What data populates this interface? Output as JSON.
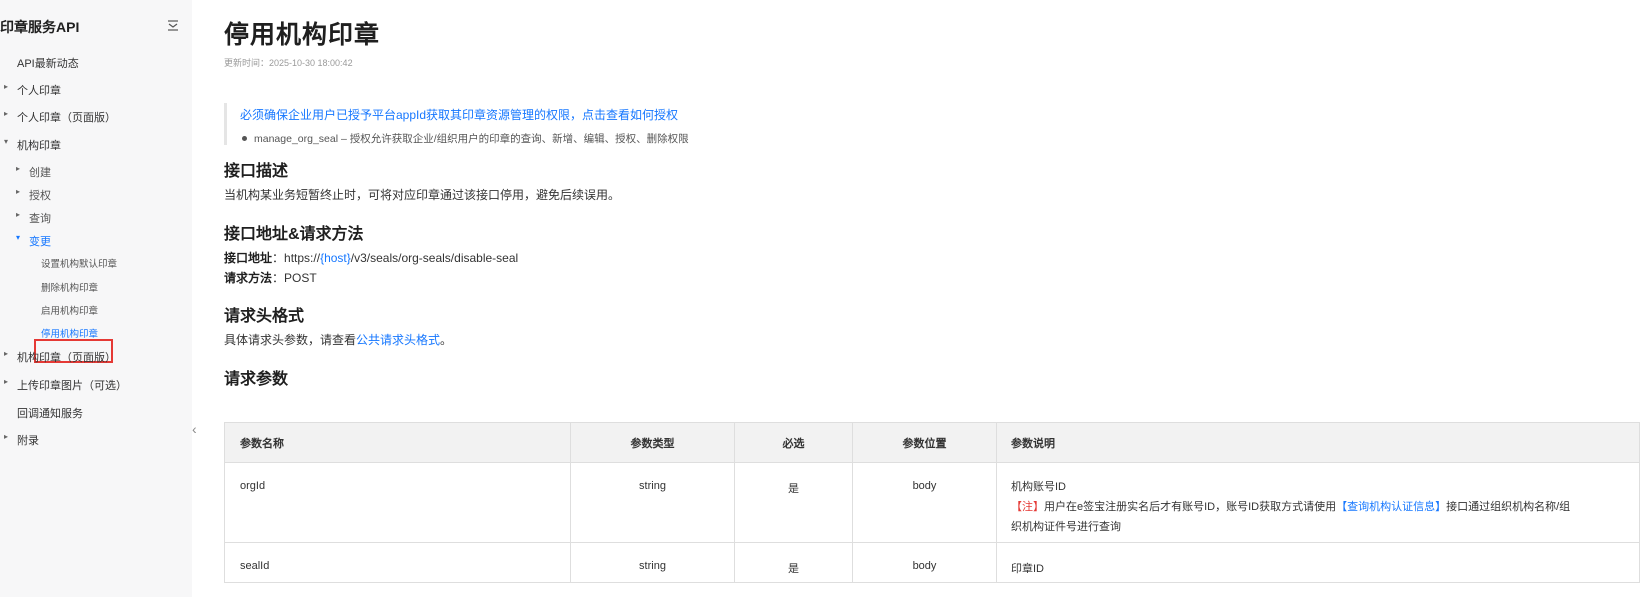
{
  "sidebar": {
    "title": "印章服务API",
    "collapse_icon": "collapse-lines-icon",
    "items": [
      {
        "label": "API最新动态"
      },
      {
        "label": "个人印章"
      },
      {
        "label": "个人印章（页面版）"
      },
      {
        "label": "机构印章"
      },
      {
        "label": "创建"
      },
      {
        "label": "授权"
      },
      {
        "label": "查询"
      },
      {
        "label": "变更"
      },
      {
        "label": "设置机构默认印章"
      },
      {
        "label": "删除机构印章"
      },
      {
        "label": "启用机构印章"
      },
      {
        "label": "停用机构印章"
      },
      {
        "label": "机构印章（页面版）"
      },
      {
        "label": "上传印章图片（可选）"
      },
      {
        "label": "回调通知服务"
      },
      {
        "label": "附录"
      }
    ]
  },
  "page": {
    "title": "停用机构印章",
    "updated": "更新时间：2025-10-30 18:00:42",
    "notice": "必须确保企业用户已授予平台appId获取其印章资源管理的权限，点击查看如何授权",
    "permission": "manage_org_seal – 授权允许获取企业/组织用户的印章的查询、新增、编辑、授权、删除权限",
    "sections": {
      "desc_title": "接口描述",
      "desc_text": "当机构某业务短暂终止时，可将对应印章通过该接口停用，避免后续误用。",
      "addr_title": "接口地址&请求方法",
      "addr_label": "接口地址",
      "addr_colon": "：",
      "addr_prefix": "https://",
      "addr_host": "{host}",
      "addr_path": "/v3/seals/org-seals/disable-seal",
      "method_label": "请求方法",
      "method_colon": "：",
      "method_value": "POST",
      "header_title": "请求头格式",
      "header_text": "具体请求头参数，请查看",
      "header_link": "公共请求头格式",
      "header_end": "。",
      "params_title": "请求参数"
    },
    "table": {
      "headers": [
        "参数名称",
        "参数类型",
        "必选",
        "参数位置",
        "参数说明"
      ],
      "rows": [
        {
          "name": "orgId",
          "type": "string",
          "required": "是",
          "position": "body",
          "desc": "机构账号ID",
          "note_tag": "【注】",
          "note_text": "用户在e签宝注册实名后才有账号ID，账号ID获取方式请使用",
          "note_link": "【查询机构认证信息】",
          "note_tail_1": "接口通过组织机构名称/组",
          "note_tail_2": "织机构证件号进行查询"
        },
        {
          "name": "sealId",
          "type": "string",
          "required": "是",
          "position": "body",
          "desc": "印章ID"
        }
      ]
    }
  }
}
